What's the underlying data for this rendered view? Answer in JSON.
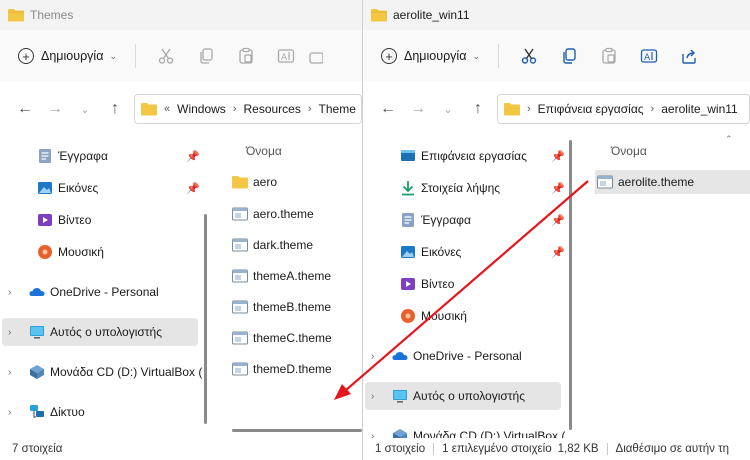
{
  "left_window": {
    "title": "Themes",
    "new_button": "Δημιουργία",
    "breadcrumb": [
      "Windows",
      "Resources",
      "Theme"
    ],
    "breadcrumb_lead": "«",
    "nav": {
      "items": [
        {
          "label": "Έγγραφα",
          "icon": "documents-icon",
          "pinned": true
        },
        {
          "label": "Εικόνες",
          "icon": "pictures-icon",
          "pinned": true
        },
        {
          "label": "Βίντεο",
          "icon": "videos-icon",
          "pinned": false
        },
        {
          "label": "Μουσική",
          "icon": "music-icon",
          "pinned": false
        },
        {
          "label": "OneDrive - Personal",
          "icon": "onedrive-icon",
          "pinned": false
        },
        {
          "label": "Αυτός ο υπολογιστής",
          "icon": "this-pc-icon",
          "pinned": false
        },
        {
          "label": "Μονάδα CD (D:) VirtualBox (",
          "icon": "cd-drive-icon",
          "pinned": false
        },
        {
          "label": "Δίκτυο",
          "icon": "network-icon",
          "pinned": false
        }
      ]
    },
    "column_header": "Όνομα",
    "files": [
      {
        "name": "aero",
        "type": "folder"
      },
      {
        "name": "aero.theme",
        "type": "theme"
      },
      {
        "name": "dark.theme",
        "type": "theme"
      },
      {
        "name": "themeA.theme",
        "type": "theme"
      },
      {
        "name": "themeB.theme",
        "type": "theme"
      },
      {
        "name": "themeC.theme",
        "type": "theme"
      },
      {
        "name": "themeD.theme",
        "type": "theme"
      }
    ],
    "status": "7 στοιχεία"
  },
  "right_window": {
    "title": "aerolite_win11",
    "new_button": "Δημιουργία",
    "breadcrumb": [
      "Επιφάνεια εργασίας",
      "aerolite_win11"
    ],
    "nav": {
      "items": [
        {
          "label": "Επιφάνεια εργασίας",
          "icon": "desktop-icon",
          "pinned": true
        },
        {
          "label": "Στοιχεία λήψης",
          "icon": "downloads-icon",
          "pinned": true
        },
        {
          "label": "Έγγραφα",
          "icon": "documents-icon",
          "pinned": true
        },
        {
          "label": "Εικόνες",
          "icon": "pictures-icon",
          "pinned": true
        },
        {
          "label": "Βίντεο",
          "icon": "videos-icon",
          "pinned": false
        },
        {
          "label": "Μουσική",
          "icon": "music-icon",
          "pinned": false
        },
        {
          "label": "OneDrive - Personal",
          "icon": "onedrive-icon",
          "pinned": false
        },
        {
          "label": "Αυτός ο υπολογιστής",
          "icon": "this-pc-icon",
          "pinned": false
        },
        {
          "label": "Μονάδα CD (D:) VirtualBox (",
          "icon": "cd-drive-icon",
          "pinned": false
        }
      ]
    },
    "column_header": "Όνομα",
    "files": [
      {
        "name": "aerolite.theme",
        "type": "theme",
        "selected": true
      }
    ],
    "status": {
      "count": "1 στοιχείο",
      "selection": "1 επιλεγμένο στοιχείο",
      "size": "1,82 KB",
      "availability": "Διαθέσιμο σε αυτήν τη"
    }
  },
  "colors": {
    "annotation_arrow": "#e8141b",
    "folder": "#f3c744",
    "selection": "#e5e5e5"
  }
}
